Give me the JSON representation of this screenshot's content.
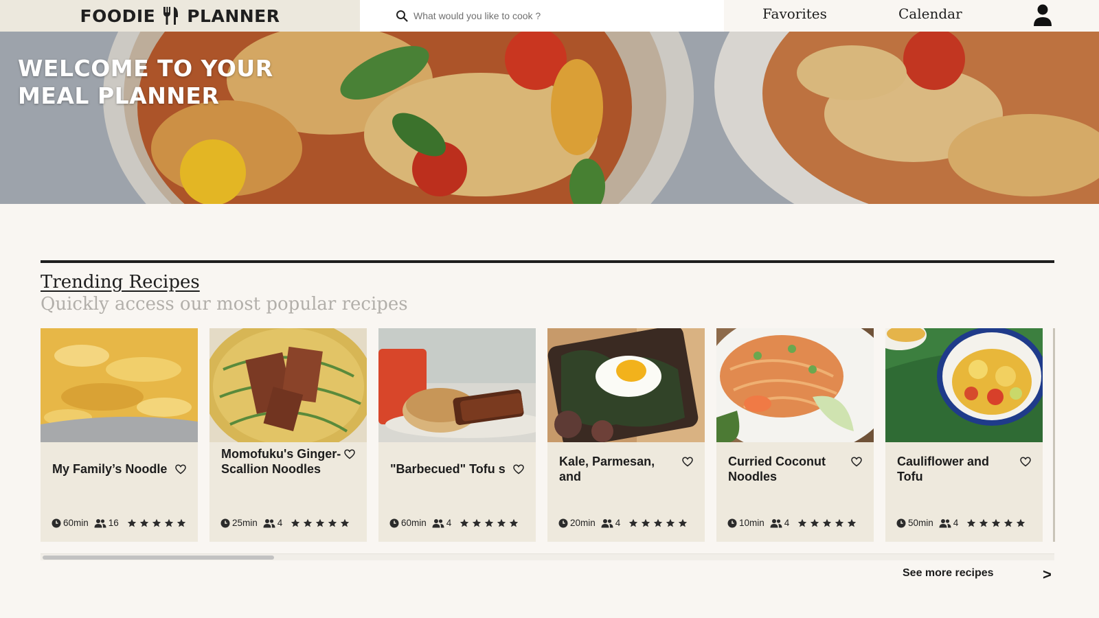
{
  "header": {
    "brand_left": "FOODIE",
    "brand_right": "PLANNER",
    "brand_icon": "fork-knife-icon",
    "search_placeholder": "What would you like to cook ?",
    "search_value": "",
    "nav": {
      "favorites": "Favorites",
      "calendar": "Calendar"
    },
    "user_icon": "user-icon"
  },
  "hero": {
    "title": "WELCOME TO YOUR MEAL PLANNER"
  },
  "trending": {
    "title": "Trending Recipes",
    "subtitle": "Quickly access our most popular recipes",
    "cards": [
      {
        "name": "My Family’s Noodle",
        "time": "60min",
        "servings": "16",
        "rating": 5
      },
      {
        "name": "Momofuku's Ginger-Scallion Noodles",
        "time": "25min",
        "servings": "4",
        "rating": 5
      },
      {
        "name": "\"Barbecued\" Tofu s",
        "time": "60min",
        "servings": "4",
        "rating": 5
      },
      {
        "name": "Kale, Parmesan, and",
        "time": "20min",
        "servings": "4",
        "rating": 5
      },
      {
        "name": "Curried Coconut Noodles",
        "time": "10min",
        "servings": "4",
        "rating": 5
      },
      {
        "name": "Cauliflower and Tofu",
        "time": "50min",
        "servings": "4",
        "rating": 5
      }
    ],
    "see_more": "See more recipes",
    "see_more_arrow": ">"
  },
  "colors": {
    "header_brand_bg": "#ece8dd",
    "page_bg": "#f9f6f2",
    "card_bg": "#eee9dd",
    "rule": "#1e1e1e",
    "subtitle": "#b2afaa"
  }
}
